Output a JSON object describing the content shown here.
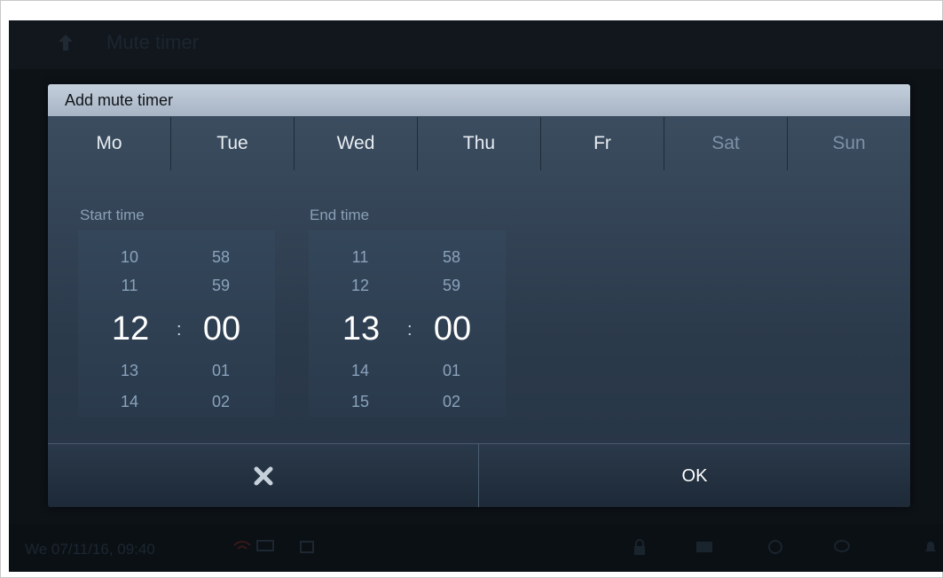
{
  "background": {
    "title": "Mute timer",
    "status_datetime": "We 07/11/16, 09:40"
  },
  "dialog": {
    "title": "Add mute timer",
    "days": [
      {
        "label": "Mo",
        "active": true
      },
      {
        "label": "Tue",
        "active": true
      },
      {
        "label": "Wed",
        "active": true
      },
      {
        "label": "Thu",
        "active": true
      },
      {
        "label": "Fr",
        "active": true
      },
      {
        "label": "Sat",
        "active": false
      },
      {
        "label": "Sun",
        "active": false
      }
    ],
    "start": {
      "label": "Start time",
      "hours_above": [
        "10",
        "11"
      ],
      "hour": "12",
      "hours_below": [
        "13",
        "14"
      ],
      "minutes_above": [
        "58",
        "59"
      ],
      "minute": "00",
      "minutes_below": [
        "01",
        "02"
      ],
      "separator": ":"
    },
    "end": {
      "label": "End time",
      "hours_above": [
        "11",
        "12"
      ],
      "hour": "13",
      "hours_below": [
        "14",
        "15"
      ],
      "minutes_above": [
        "58",
        "59"
      ],
      "minute": "00",
      "minutes_below": [
        "01",
        "02"
      ],
      "separator": ":"
    },
    "cancel_icon": "close-icon",
    "ok_label": "OK"
  },
  "colors": {
    "active_day": "#e8edf2",
    "inactive_day": "#7d92a6",
    "title_bar": "#b6c2d1",
    "dialog_bg": "#2f4052"
  }
}
